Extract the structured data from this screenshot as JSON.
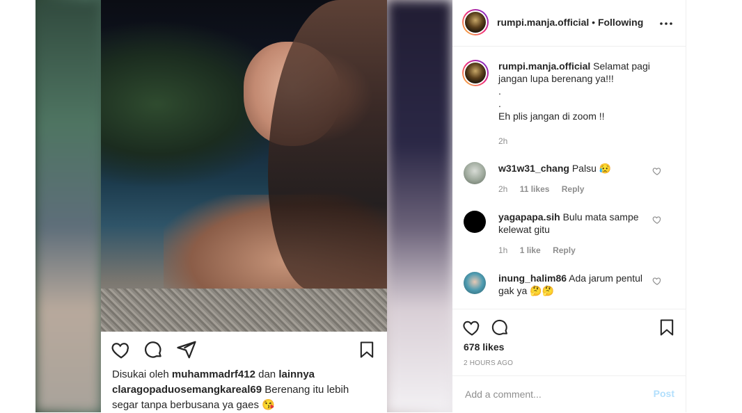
{
  "post": {
    "photo_actions": {
      "icons": [
        "heart-icon",
        "comment-icon",
        "share-icon",
        "bookmark-icon"
      ]
    },
    "photo_caption": {
      "liked_prefix": "Disukai oleh",
      "liked_user": "muhammadrf412",
      "liked_and": "dan",
      "liked_others": "lainnya",
      "comment_user": "claragopaduosemangkareal69",
      "comment_text": "Berenang itu lebih segar tanpa berbusana ya gaes",
      "comment_emoji": "😘"
    }
  },
  "header": {
    "username": "rumpi.manja.official",
    "separator": "•",
    "follow_status": "Following",
    "more_icon": "more-dots-icon"
  },
  "caption": {
    "username": "rumpi.manja.official",
    "line1": "Selamat pagi jangan lupa berenang ya!!!",
    "line2": ".",
    "line3": ".",
    "line4": "Eh plis jangan di zoom !!",
    "time": "2h"
  },
  "comments": [
    {
      "username": "w31w31_chang",
      "text": "Palsu",
      "emoji": "😥",
      "time": "2h",
      "likes": "11 likes",
      "reply": "Reply"
    },
    {
      "username": "yagapapa.sih",
      "text": "Bulu mata sampe kelewat gitu",
      "emoji": "",
      "time": "1h",
      "likes": "1 like",
      "reply": "Reply"
    },
    {
      "username": "inung_halim86",
      "text": "Ada jarum pentul gak ya",
      "emoji": "🤔🤔",
      "time": "",
      "likes": "",
      "reply": ""
    }
  ],
  "actions": {
    "likes": "678 likes",
    "time": "2 HOURS AGO"
  },
  "add_comment": {
    "placeholder": "Add a comment...",
    "post_label": "Post"
  },
  "colors": {
    "text": "#262626",
    "muted": "#8e8e8e",
    "post_disabled": "#b2dffc",
    "border": "#efefef"
  }
}
